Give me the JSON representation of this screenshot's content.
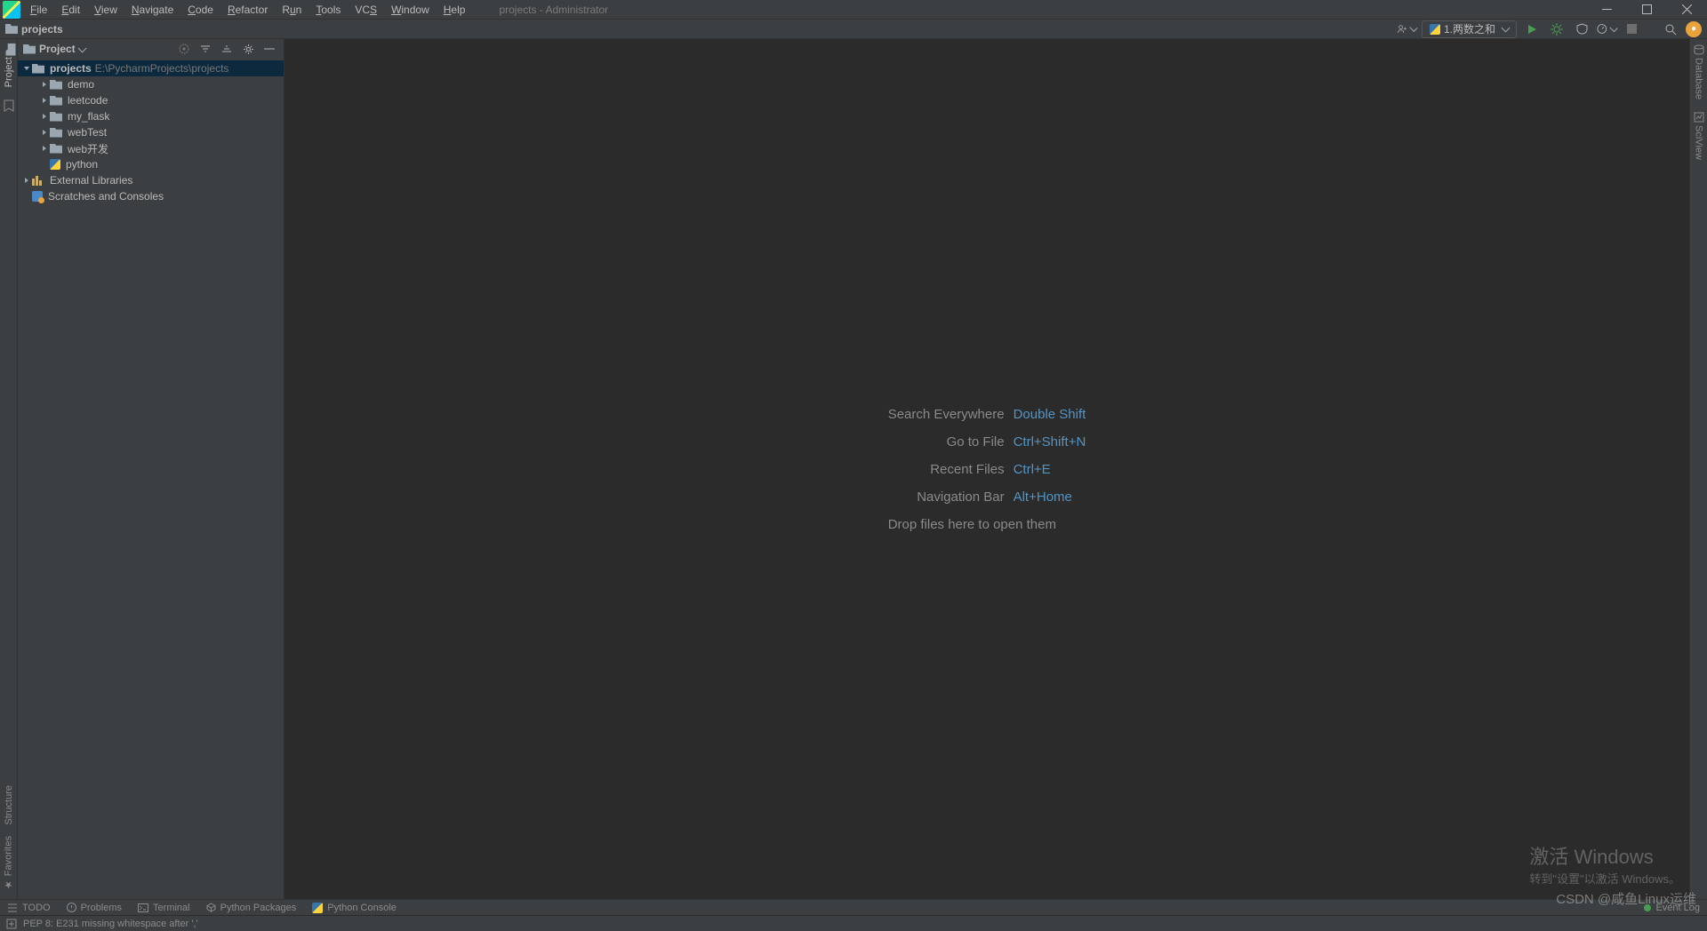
{
  "window": {
    "title": "projects - Administrator"
  },
  "menu": {
    "items": [
      "File",
      "Edit",
      "View",
      "Navigate",
      "Code",
      "Refactor",
      "Run",
      "Tools",
      "VCS",
      "Window",
      "Help"
    ]
  },
  "breadcrumb": {
    "root": "projects"
  },
  "toolbar_right": {
    "run_config": "1.两数之和"
  },
  "project_panel": {
    "title": "Project",
    "root_name": "projects",
    "root_path": "E:\\PycharmProjects\\projects",
    "folders": [
      "demo",
      "leetcode",
      "my_flask",
      "webTest",
      "web开发"
    ],
    "python_file": "python",
    "external_libs": "External Libraries",
    "scratches": "Scratches and Consoles"
  },
  "hints": {
    "search": {
      "label": "Search Everywhere",
      "key": "Double Shift"
    },
    "goto": {
      "label": "Go to File",
      "key": "Ctrl+Shift+N"
    },
    "recent": {
      "label": "Recent Files",
      "key": "Ctrl+E"
    },
    "navbar": {
      "label": "Navigation Bar",
      "key": "Alt+Home"
    },
    "drop": "Drop files here to open them"
  },
  "left_strip": {
    "project_label": "Project",
    "structure_label": "Structure",
    "favorites_label": "Favorites"
  },
  "right_strip": {
    "database_label": "Database",
    "sciview_label": "SciView"
  },
  "bottom_tools": {
    "todo": "TODO",
    "problems": "Problems",
    "terminal": "Terminal",
    "packages": "Python Packages",
    "console": "Python Console",
    "event_log": "Event Log"
  },
  "statusbar": {
    "message": "PEP 8: E231 missing whitespace after ','"
  },
  "watermark": {
    "line1": "激活 Windows",
    "line2": "转到\"设置\"以激活 Windows。"
  },
  "csdn": "CSDN @咸鱼Linux运维"
}
